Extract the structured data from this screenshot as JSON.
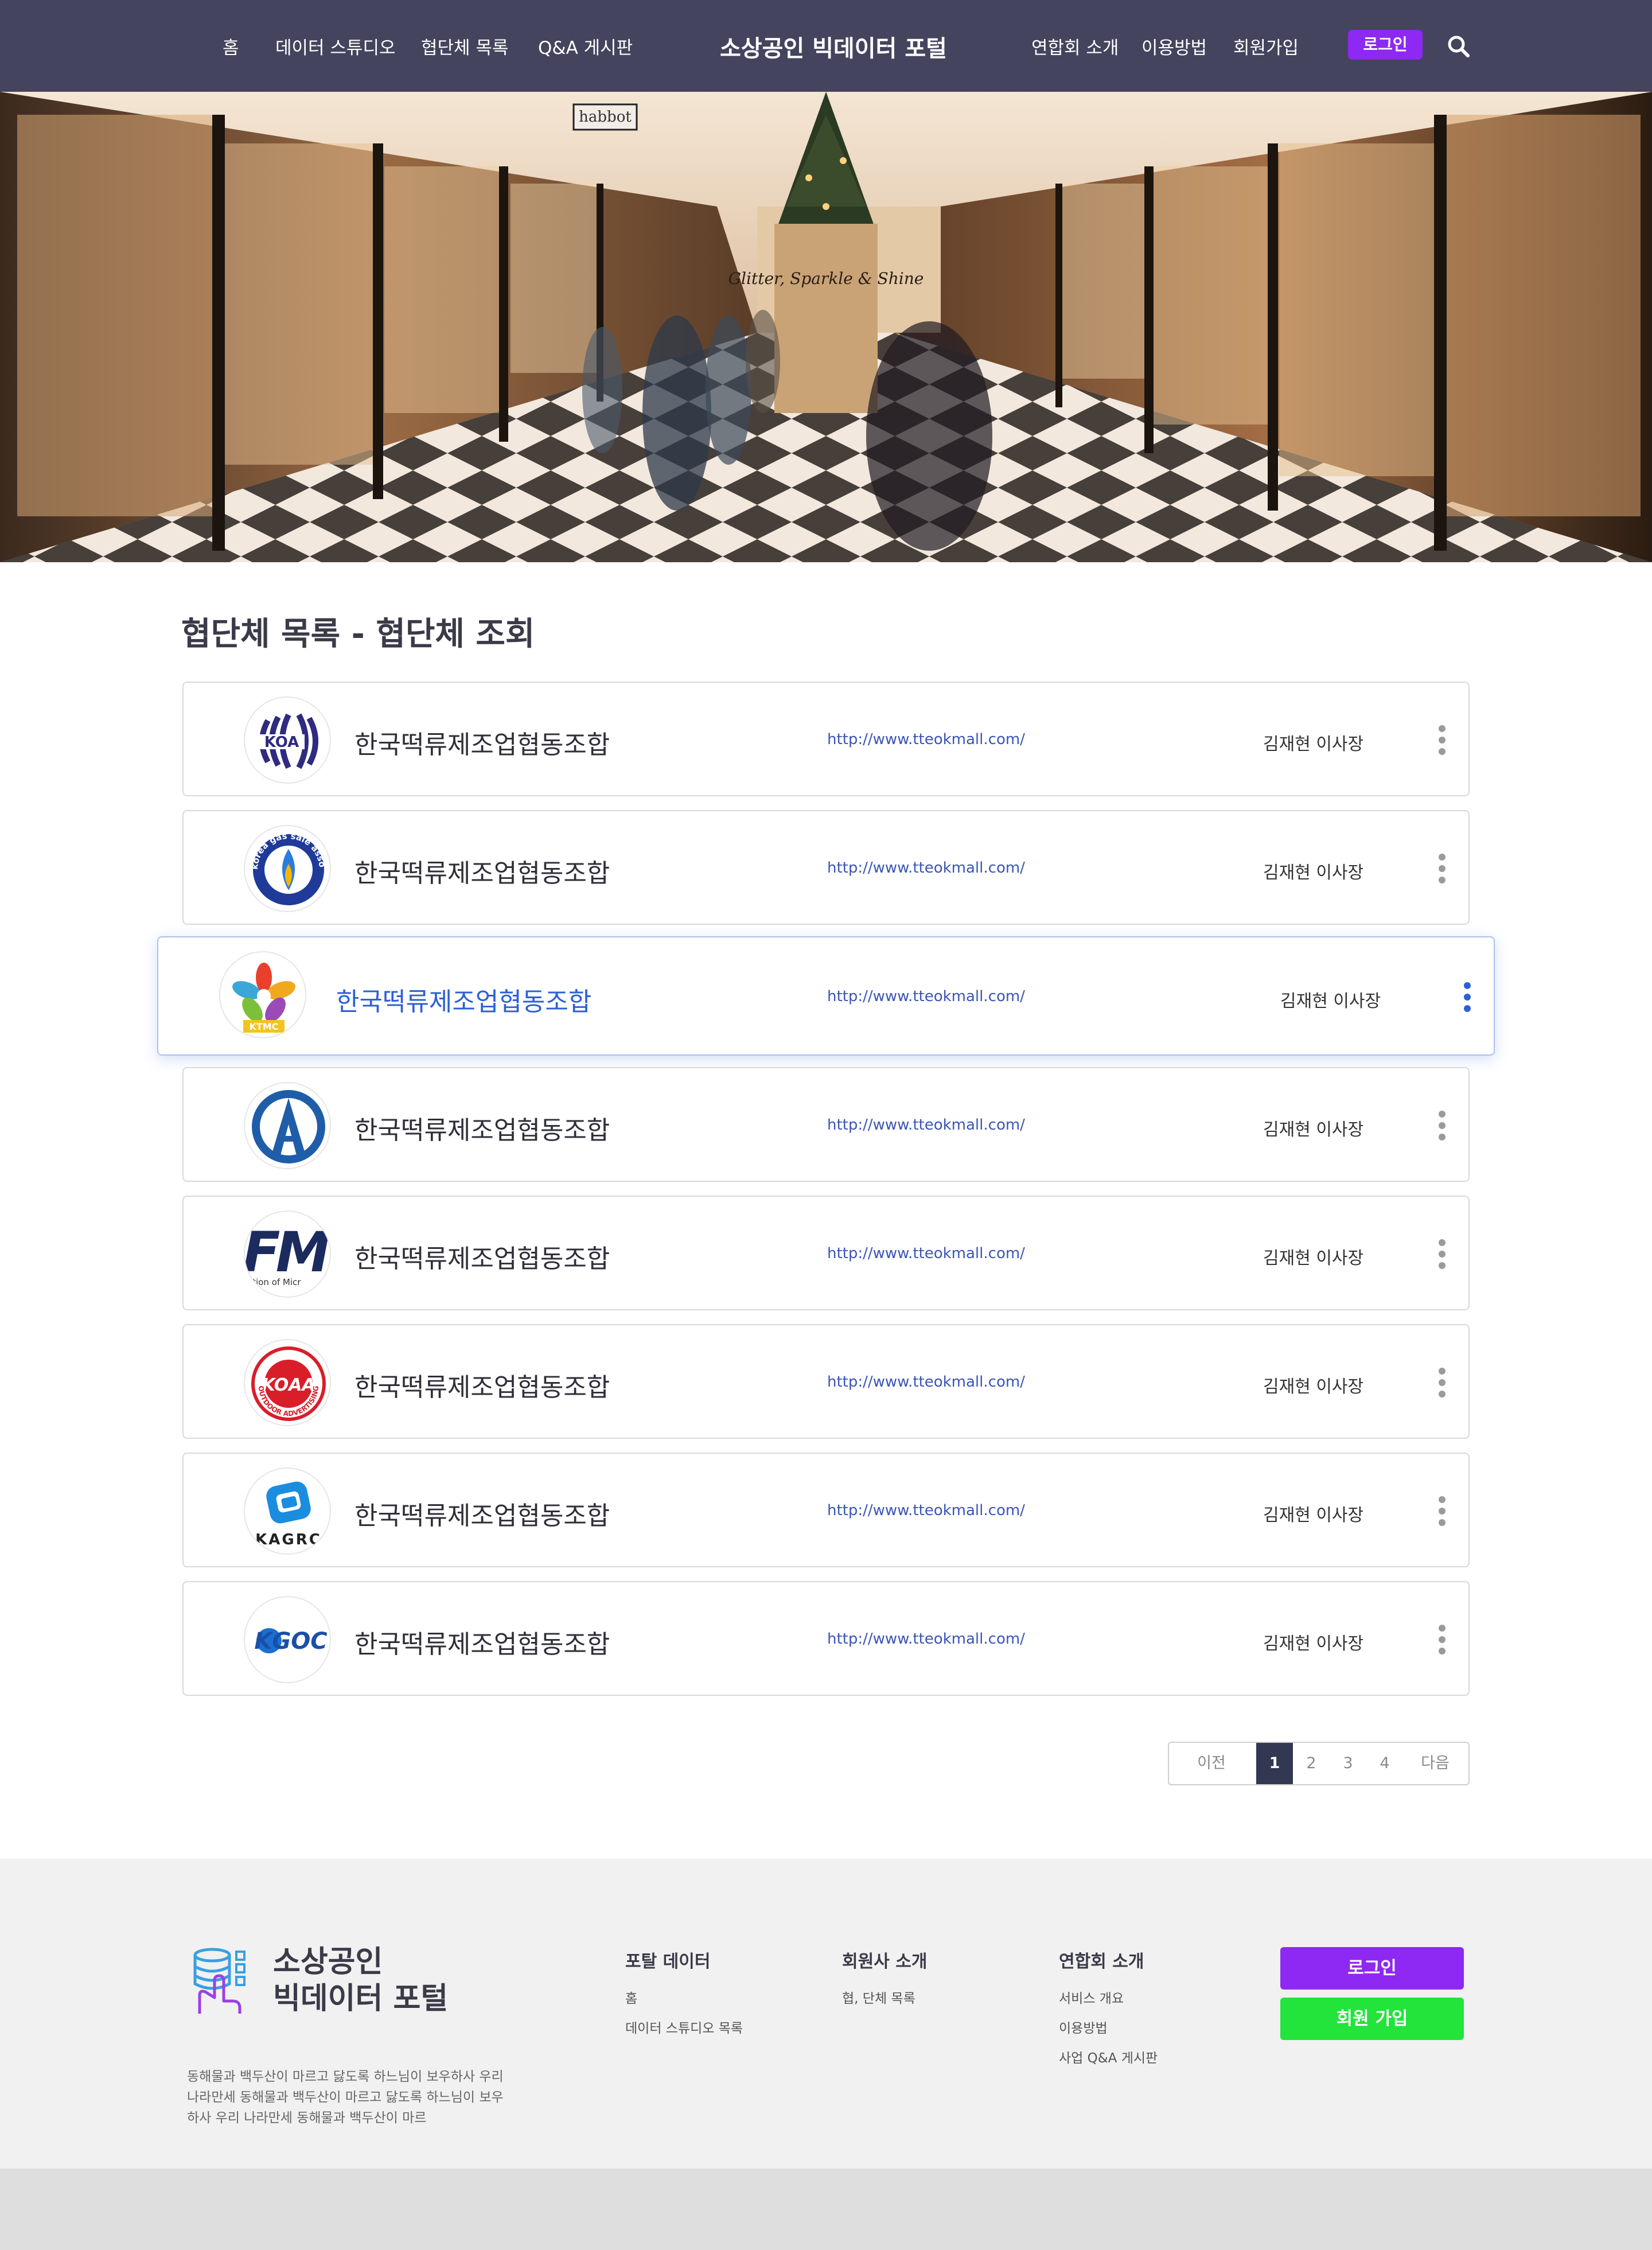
{
  "header": {
    "nav_left": [
      "홈",
      "데이터 스튜디오",
      "협단체 목록",
      "Q&A 게시판"
    ],
    "brand": "소상공인 빅데이터 포털",
    "nav_right": [
      "연합회 소개",
      "이용방법",
      "회원가입"
    ],
    "login_label": "로그인",
    "colors": {
      "bar": "#45445e",
      "login": "#8d29f2"
    }
  },
  "page": {
    "title": "협단체 목록 - 협단체 조회"
  },
  "organizations": [
    {
      "name": "한국떡류제조업협동조합",
      "url": "http://www.tteokmall.com/",
      "ceo": "김재현 이사장",
      "logo_text": "KOA",
      "logo_icon": "koa-arcs-logo-icon"
    },
    {
      "name": "한국떡류제조업협동조합",
      "url": "http://www.tteokmall.com/",
      "ceo": "김재현 이사장",
      "logo_text": "korea gas sale association · K.G.S.A",
      "logo_icon": "gas-flame-logo-icon"
    },
    {
      "name": "한국떡류제조업협동조합",
      "url": "http://www.tteokmall.com/",
      "ceo": "김재현 이사장",
      "logo_text": "KTMC",
      "logo_icon": "flower-petal-logo-icon",
      "active": true
    },
    {
      "name": "한국떡류제조업협동조합",
      "url": "http://www.tteokmall.com/",
      "ceo": "김재현 이사장",
      "logo_text": "",
      "logo_icon": "letter-a-circle-logo-icon"
    },
    {
      "name": "한국떡류제조업협동조합",
      "url": "http://www.tteokmall.com/",
      "ceo": "김재현 이사장",
      "logo_text": "FM",
      "logo_sub": "ation of Micr",
      "logo_icon": "fm-logo-icon"
    },
    {
      "name": "한국떡류제조업협동조합",
      "url": "http://www.tteokmall.com/",
      "ceo": "김재현 이사장",
      "logo_text": "KOAA",
      "logo_sub": "OUTDOOR ADVERTISING",
      "logo_icon": "koaa-seal-logo-icon"
    },
    {
      "name": "한국떡류제조업협동조합",
      "url": "http://www.tteokmall.com/",
      "ceo": "김재현 이사장",
      "logo_text": "KAGRC",
      "logo_icon": "kagrc-logo-icon"
    },
    {
      "name": "한국떡류제조업협동조합",
      "url": "http://www.tteokmall.com/",
      "ceo": "김재현 이사장",
      "logo_text": "KGOC",
      "logo_icon": "kgoc-logo-icon"
    }
  ],
  "pagination": {
    "prev": "이전",
    "pages": [
      "1",
      "2",
      "3",
      "4"
    ],
    "current": "1",
    "next": "다음"
  },
  "footer": {
    "brand_line1": "소상공인",
    "brand_line2": "빅데이터 포털",
    "description": "동해물과 백두산이 마르고 닳도록 하느님이 보우하사 우리 나라만세 동해물과 백두산이 마르고 닳도록 하느님이 보우하사 우리 나라만세 동해물과 백두산이 마르",
    "columns": [
      {
        "title": "포탈 데이터",
        "links": [
          "홈",
          "데이터 스튜디오 목록"
        ]
      },
      {
        "title": "회원사 소개",
        "links": [
          "협, 단체 목록"
        ]
      },
      {
        "title": "연합회 소개",
        "links": [
          "서비스 개요",
          "이용방법",
          "사업 Q&A 게시판"
        ]
      }
    ],
    "login_label": "로그인",
    "signup_label": "회원 가입",
    "colors": {
      "login": "#8d29f2",
      "signup": "#22e43a"
    }
  },
  "hero": {
    "sign_text": "Glitter, Sparkle & Shine",
    "shop_sign": "habbot"
  }
}
